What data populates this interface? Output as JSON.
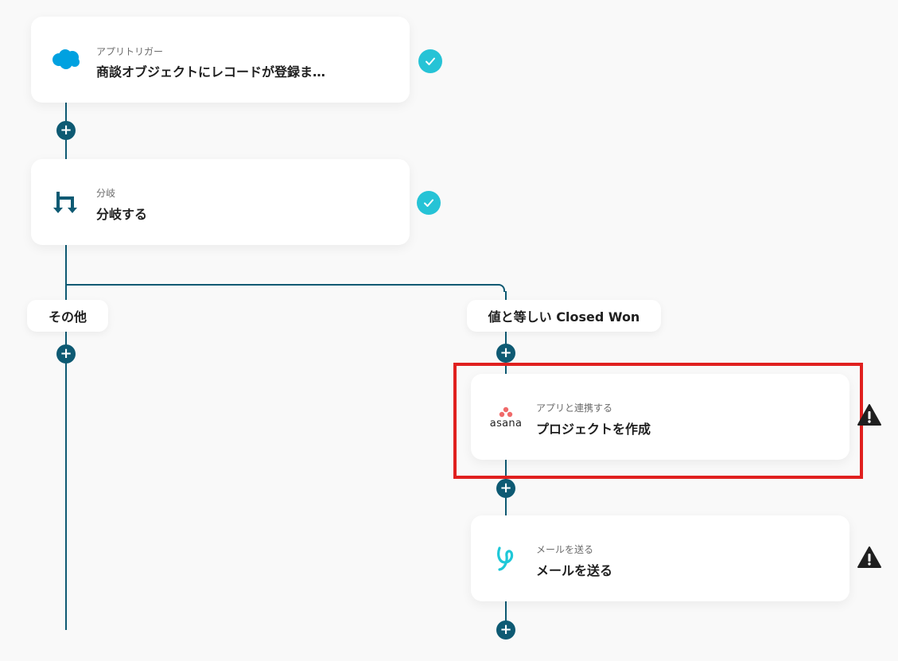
{
  "flow": {
    "trigger": {
      "subtitle": "アプリトリガー",
      "title": "商談オブジェクトにレコードが登録ま…",
      "app_icon": "salesforce-cloud-icon",
      "status": "completed"
    },
    "branch": {
      "subtitle": "分岐",
      "title": "分岐する",
      "app_icon": "branch-icon",
      "status": "completed"
    },
    "branch_left": {
      "label": "その他"
    },
    "branch_right": {
      "label": "値と等しい Closed Won"
    },
    "asana_step": {
      "subtitle": "アプリと連携する",
      "title": "プロジェクトを作成",
      "app_icon": "asana-logo-icon",
      "logo_text": "asana",
      "status": "warning"
    },
    "mail_step": {
      "subtitle": "メールを送る",
      "title": "メールを送る",
      "app_icon": "yoom-mail-icon",
      "status": "warning"
    }
  },
  "colors": {
    "line": "#0e5a73",
    "check": "#26c3d6",
    "highlight": "#e0201f",
    "salesforce": "#00a1e0",
    "asana": "#f06a6a",
    "mail": "#1ec8d8"
  }
}
